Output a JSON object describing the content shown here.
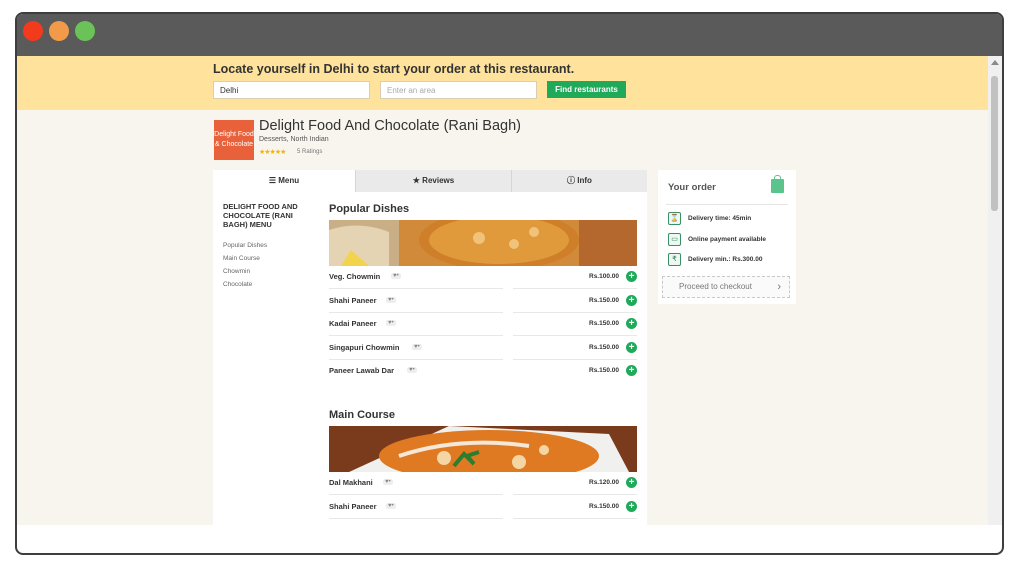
{
  "banner": {
    "title": "Locate yourself in Delhi to start your order at this restaurant.",
    "city_value": "Delhi",
    "area_placeholder": "Enter an area",
    "find_label": "Find restaurants"
  },
  "restaurant": {
    "logo_text": "Delight Food & Chocolate",
    "name": "Delight Food And Chocolate (Rani Bagh)",
    "cuisine": "Desserts, North Indian",
    "stars": "★★★★★",
    "rating_value": 4.5,
    "ratings_label": "5 Ratings"
  },
  "tabs": [
    {
      "label": "☰ Menu"
    },
    {
      "label": "★ Reviews"
    },
    {
      "label": "ⓘ Info"
    }
  ],
  "sidebar": {
    "title": "DELIGHT FOOD AND CHOCOLATE (RANI BAGH) MENU",
    "links": [
      "Popular Dishes",
      "Main Course",
      "Chowmin",
      "Chocolate"
    ]
  },
  "sections": [
    {
      "title": "Popular Dishes",
      "dishes": [
        {
          "name": "Veg. Chowmin",
          "price": "Rs.100.00"
        },
        {
          "name": "Shahi Paneer",
          "price": "Rs.150.00"
        },
        {
          "name": "Kadai Paneer",
          "price": "Rs.150.00"
        },
        {
          "name": "Singapuri Chowmin",
          "price": "Rs.150.00"
        },
        {
          "name": "Paneer Lawab Dar",
          "price": "Rs.150.00"
        }
      ]
    },
    {
      "title": "Main Course",
      "dishes": [
        {
          "name": "Dal Makhani",
          "price": "Rs.120.00"
        },
        {
          "name": "Shahi Paneer",
          "price": "Rs.150.00"
        }
      ]
    }
  ],
  "veg_badge": "♥•",
  "add_icon": "+",
  "order": {
    "title": "Your order",
    "delivery_time": "Delivery time: 45min",
    "online_payment": "Online payment available",
    "delivery_min": "Delivery min.: Rs.300.00",
    "checkout_label": "Proceed to checkout"
  },
  "colors": {
    "banner_bg": "#ffe39c",
    "accent_green": "#1faa59",
    "logo_orange": "#e8613a",
    "page_bg": "#f8f5ee"
  }
}
